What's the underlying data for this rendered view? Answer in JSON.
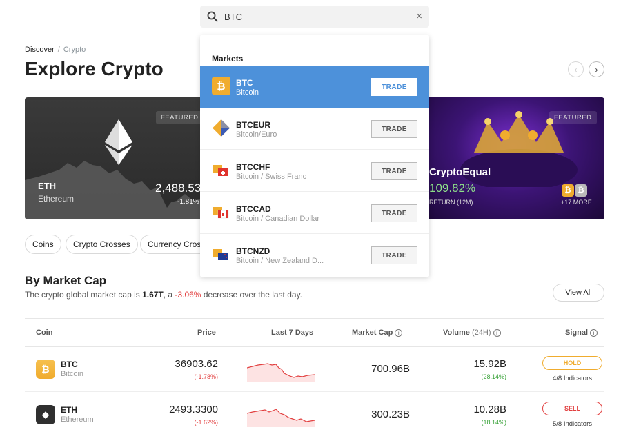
{
  "search": {
    "value": "BTC",
    "clear_glyph": "×",
    "icon": "search-icon"
  },
  "breadcrumb": {
    "items": [
      "Discover",
      "Crypto"
    ],
    "separator": "/"
  },
  "page": {
    "title": "Explore Crypto"
  },
  "carousel": {
    "prev_glyph": "‹",
    "next_glyph": "›",
    "left_card": {
      "badge": "FEATURED",
      "symbol": "ETH",
      "name": "Ethereum",
      "price": "2,488.53",
      "change": "-1.81%"
    },
    "right_card": {
      "badge": "FEATURED",
      "name": "CryptoEqual",
      "return_value": "109.82%",
      "return_label": "RETURN (12M)",
      "more": "+17 MORE"
    }
  },
  "chips": [
    "Coins",
    "Crypto Crosses",
    "Currency Cross"
  ],
  "market_cap_section": {
    "title": "By Market Cap",
    "sub_prefix": "The crypto global market cap is ",
    "sub_value": "1.67T",
    "sub_mid": ", a ",
    "sub_change": "-3.06%",
    "sub_suffix": " decrease over the last day.",
    "view_all": "View All"
  },
  "table": {
    "headers": {
      "coin": "Coin",
      "price": "Price",
      "last7": "Last 7 Days",
      "market_cap": "Market Cap",
      "volume": "Volume",
      "volume_suffix": "(24H)",
      "signal": "Signal",
      "info_glyph": "i"
    },
    "rows": [
      {
        "symbol": "BTC",
        "name": "Bitcoin",
        "price": "36903.62",
        "change": "(-1.78%)",
        "market_cap": "700.96B",
        "volume": "15.92B",
        "volume_change": "(28.14%)",
        "signal": "HOLD",
        "indicators": "4/8 Indicators",
        "signal_color": "#f0ac2e",
        "icon_glyph": "₿"
      },
      {
        "symbol": "ETH",
        "name": "Ethereum",
        "price": "2493.3300",
        "change": "(-1.62%)",
        "market_cap": "300.23B",
        "volume": "10.28B",
        "volume_change": "(18.14%)",
        "signal": "SELL",
        "indicators": "5/8 Indicators",
        "signal_color": "#e24040",
        "icon_glyph": "◆"
      }
    ]
  },
  "dropdown": {
    "heading": "Markets",
    "trade_label": "TRADE",
    "items": [
      {
        "symbol": "BTC",
        "name": "Bitcoin",
        "active": true
      },
      {
        "symbol": "BTCEUR",
        "name": "Bitcoin/Euro",
        "active": false
      },
      {
        "symbol": "BTCCHF",
        "name": "Bitcoin / Swiss Franc",
        "active": false
      },
      {
        "symbol": "BTCCAD",
        "name": "Bitcoin / Canadian Dollar",
        "active": false
      },
      {
        "symbol": "BTCNZD",
        "name": "Bitcoin / New Zealand D...",
        "active": false
      }
    ]
  },
  "colors": {
    "accent_blue": "#4d91da",
    "negative": "#e24040",
    "positive": "#3aa33a",
    "bitcoin": "#f0ac2e"
  }
}
